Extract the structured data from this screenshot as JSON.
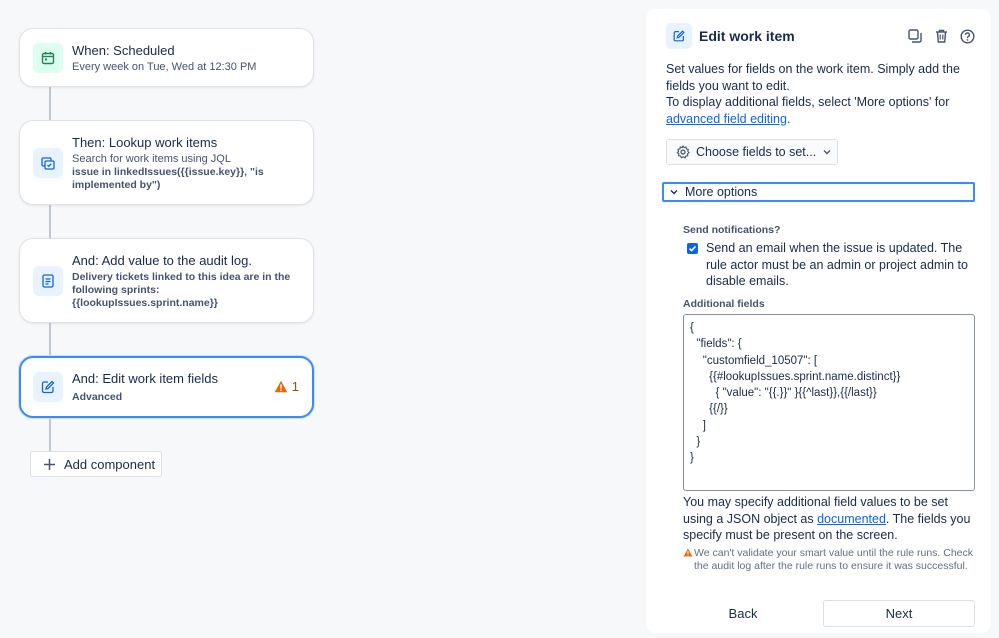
{
  "rule": {
    "trigger": {
      "title": "When: Scheduled",
      "subtitle": "Every week on Tue, Wed at 12:30 PM",
      "icon": "calendar-icon"
    },
    "lookup": {
      "title": "Then: Lookup work items",
      "subtitle": "Search for work items using JQL",
      "query": "issue in linkedIssues({{issue.key}}, \"is implemented by\")",
      "icon": "lookup-icon"
    },
    "audit": {
      "title": "And: Add value to the audit log.",
      "message": "Delivery tickets linked to this idea are in the following sprints: {{lookupIssues.sprint.name}}",
      "icon": "audit-log-icon"
    },
    "edit": {
      "title": "And: Edit work item fields",
      "subtitle": "Advanced",
      "warning_count": "1",
      "icon": "edit-icon"
    },
    "add_component_label": "Add component"
  },
  "panel": {
    "title": "Edit work item",
    "intro_line1": "Set values for fields on the work item. Simply add the fields you want to edit.",
    "intro_line2": "To display additional fields, select 'More options' for",
    "intro_link": "advanced field editing",
    "intro_end": ".",
    "choose_fields_label": "Choose fields to set...",
    "more_options_label": "More options",
    "send_notifications_label": "Send notifications?",
    "send_notifications_checked": true,
    "send_notifications_text": "Send an email when the issue is updated. The rule actor must be an admin or project admin to disable emails.",
    "additional_fields_label": "Additional fields",
    "additional_fields_value": "{\n  \"fields\": {\n    \"customfield_10507\": [\n      {{#lookupIssues.sprint.name.distinct}}\n        { \"value\": \"{{.}}\" }{{^last}},{{/last}}\n      {{/}}\n    ]\n  }\n}",
    "help_start": "You may specify additional field values to be set using a JSON object as ",
    "help_link": "documented",
    "help_end": ". The fields you specify must be present on the screen.",
    "warning_text": "We can't validate your smart value until the rule runs. Check the audit log after the rule runs to ensure it was successful.",
    "back_label": "Back",
    "next_label": "Next"
  },
  "colors": {
    "accent": "#0c66e4",
    "warning": "#e56910",
    "trigger_icon_bg": "#dcfff1",
    "action_icon_bg": "#e9f2ff"
  }
}
